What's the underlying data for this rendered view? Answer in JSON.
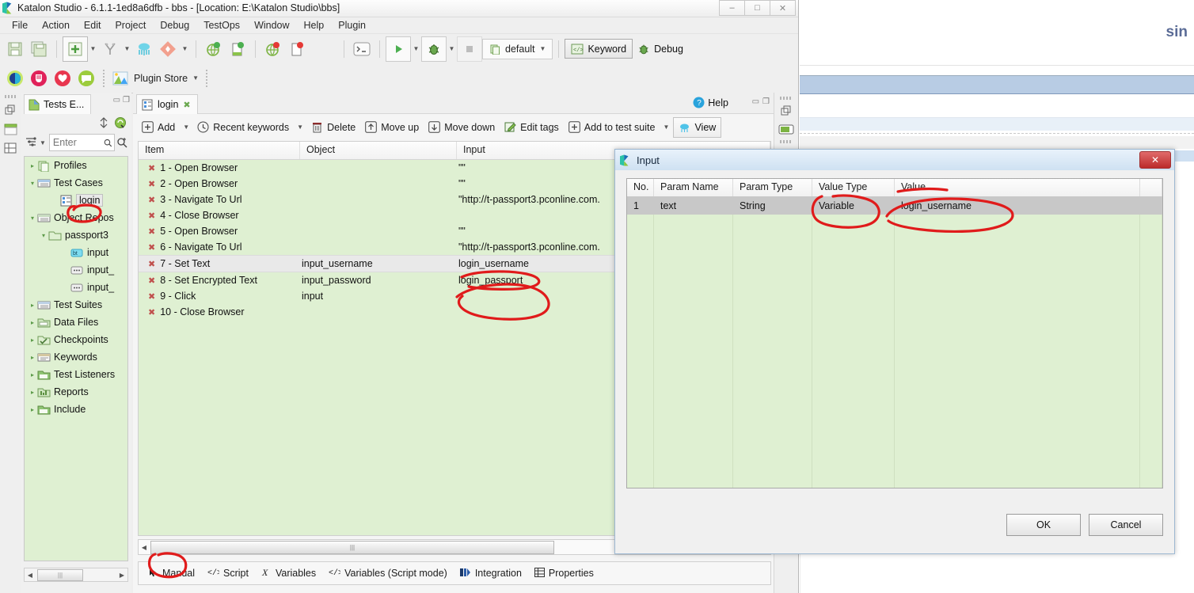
{
  "window": {
    "title": "Katalon Studio - 6.1.1-1ed8a6dfb - bbs - [Location: E:\\Katalon Studio\\bbs]",
    "minimize": "–",
    "maximize": "□",
    "close": "✕"
  },
  "menubar": {
    "items": [
      "File",
      "Action",
      "Edit",
      "Project",
      "Debug",
      "TestOps",
      "Window",
      "Help",
      "Plugin"
    ]
  },
  "toolbar": {
    "icons": [
      "save-icon",
      "save-all-icon",
      "new-item-icon",
      "new-item-dropdown-icon",
      "cut-record-icon",
      "record-dropdown-icon",
      "spy-web-icon",
      "git-icon",
      "git-dropdown-icon",
      "record-web-icon",
      "record-mobile-icon",
      "spy-web-red-icon",
      "spy-mobile-red-icon"
    ],
    "plugin_store": "Plugin Store",
    "console_icon": "console-icon",
    "run_icon": "run-icon",
    "debug_icon": "debug-icon",
    "stop_icon": "stop-icon",
    "profile": "default",
    "keyword_label": "Keyword",
    "debug_label": "Debug"
  },
  "explorer": {
    "tab_label": "Tests E...",
    "search_placeholder": "Enter",
    "tree": [
      {
        "label": "Profiles",
        "depth": 0,
        "arrow": "▸",
        "icon": "profiles-icon",
        "selected": false
      },
      {
        "label": "Test Cases",
        "depth": 0,
        "arrow": "▾",
        "icon": "test-cases-icon",
        "selected": false
      },
      {
        "label": "login",
        "depth": 2,
        "arrow": "",
        "icon": "test-case-icon",
        "selected": true
      },
      {
        "label": "Object Repos",
        "depth": 0,
        "arrow": "▾",
        "icon": "object-repository-icon",
        "selected": false
      },
      {
        "label": "passport3",
        "depth": 1,
        "arrow": "▾",
        "icon": "folder-icon",
        "selected": false
      },
      {
        "label": "input",
        "depth": 3,
        "arrow": "",
        "icon": "bt-object-icon",
        "selected": false
      },
      {
        "label": "input_",
        "depth": 3,
        "arrow": "",
        "icon": "object-icon",
        "selected": false
      },
      {
        "label": "input_",
        "depth": 3,
        "arrow": "",
        "icon": "object-icon",
        "selected": false
      },
      {
        "label": "Test Suites",
        "depth": 0,
        "arrow": "▸",
        "icon": "test-suites-icon",
        "selected": false
      },
      {
        "label": "Data Files",
        "depth": 0,
        "arrow": "▸",
        "icon": "data-files-icon",
        "selected": false
      },
      {
        "label": "Checkpoints",
        "depth": 0,
        "arrow": "▸",
        "icon": "checkpoints-icon",
        "selected": false
      },
      {
        "label": "Keywords",
        "depth": 0,
        "arrow": "▸",
        "icon": "keywords-icon",
        "selected": false
      },
      {
        "label": "Test Listeners",
        "depth": 0,
        "arrow": "▸",
        "icon": "test-listeners-icon",
        "selected": false
      },
      {
        "label": "Reports",
        "depth": 0,
        "arrow": "▸",
        "icon": "reports-icon",
        "selected": false
      },
      {
        "label": "Include",
        "depth": 0,
        "arrow": "▸",
        "icon": "include-icon",
        "selected": false
      }
    ]
  },
  "editor": {
    "tab_label": "login",
    "help_label": "Help",
    "toolbar": [
      {
        "label": "Add",
        "icon": "plus-circle-icon",
        "dropdown": true
      },
      {
        "label": "Recent keywords",
        "icon": "clock-icon",
        "dropdown": true
      },
      {
        "label": "Delete",
        "icon": "trash-icon",
        "dropdown": false
      },
      {
        "label": "Move up",
        "icon": "arrow-up-icon",
        "dropdown": false
      },
      {
        "label": "Move down",
        "icon": "arrow-down-icon",
        "dropdown": false
      },
      {
        "label": "Edit tags",
        "icon": "edit-tags-icon",
        "dropdown": false
      },
      {
        "label": "Add to test suite",
        "icon": "plus-circle-icon",
        "dropdown": true
      }
    ],
    "view_button": "View",
    "columns": [
      "Item",
      "Object",
      "Input"
    ],
    "rows": [
      {
        "item": "1 - Open Browser",
        "object": "",
        "input": "\"\""
      },
      {
        "item": "2 - Open Browser",
        "object": "",
        "input": "\"\""
      },
      {
        "item": "3 - Navigate To Url",
        "object": "",
        "input": "\"http://t-passport3.pconline.com."
      },
      {
        "item": "4 - Close Browser",
        "object": "",
        "input": ""
      },
      {
        "item": "5 - Open Browser",
        "object": "",
        "input": "\"\""
      },
      {
        "item": "6 - Navigate To Url",
        "object": "",
        "input": "\"http://t-passport3.pconline.com."
      },
      {
        "item": "7 - Set Text",
        "object": "input_username",
        "input": "login_username",
        "selected": true
      },
      {
        "item": "8 - Set Encrypted Text",
        "object": "input_password",
        "input": "login_passport"
      },
      {
        "item": "9 - Click",
        "object": "input",
        "input": ""
      },
      {
        "item": "10 - Close Browser",
        "object": "",
        "input": ""
      }
    ],
    "bottom_tabs": [
      {
        "label": "Manual",
        "icon": "cursor-icon",
        "active": true
      },
      {
        "label": "Script",
        "icon": "code-icon",
        "active": false
      },
      {
        "label": "Variables",
        "icon": "variable-x-icon",
        "active": false
      },
      {
        "label": "Variables (Script mode)",
        "icon": "code-icon",
        "active": false
      },
      {
        "label": "Integration",
        "icon": "integration-icon",
        "active": false
      },
      {
        "label": "Properties",
        "icon": "properties-grid-icon",
        "active": false
      }
    ]
  },
  "dialog": {
    "title": "Input",
    "close": "✕",
    "columns": [
      "No.",
      "Param Name",
      "Param Type",
      "Value Type",
      "Value"
    ],
    "rows": [
      {
        "no": "1",
        "param_name": "text",
        "param_type": "String",
        "value_type": "Variable",
        "value": "login_username"
      }
    ],
    "empty_row_count": 16,
    "ok": "OK",
    "cancel": "Cancel"
  },
  "background": {
    "text": "sin"
  },
  "annotation": {
    "color": "#e01b1b",
    "marks": [
      "login-tree-circle",
      "input-column-circle",
      "manual-tab-circle",
      "value-type-circle",
      "value-circle"
    ]
  }
}
